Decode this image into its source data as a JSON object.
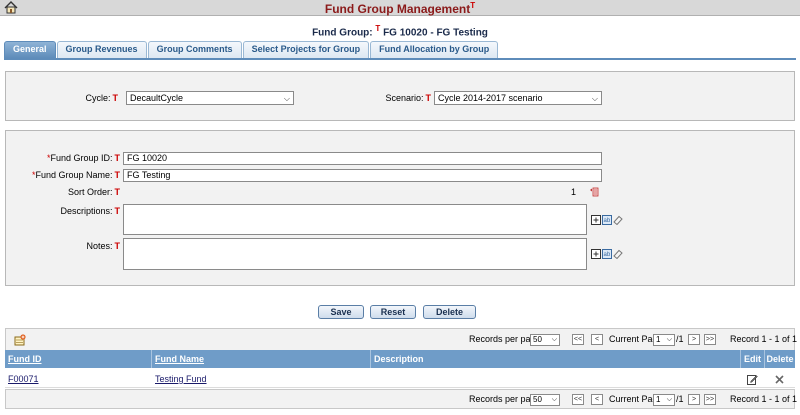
{
  "title_bar": {
    "title": "Fund Group Management",
    "t_marker": "T"
  },
  "fund_group": {
    "label": "Fund Group:",
    "t_marker": "T",
    "value": "FG 10020 - FG Testing"
  },
  "tabs": [
    {
      "label": "General",
      "active": true
    },
    {
      "label": "Group Revenues",
      "active": false
    },
    {
      "label": "Group Comments",
      "active": false
    },
    {
      "label": "Select Projects for Group",
      "active": false
    },
    {
      "label": "Fund Allocation by Group",
      "active": false
    }
  ],
  "filters": {
    "cycle": {
      "label": "Cycle:",
      "t_marker": "T",
      "value": "DecaultCycle"
    },
    "scenario": {
      "label": "Scenario:",
      "t_marker": "T",
      "value": "Cycle 2014-2017 scenario"
    }
  },
  "form": {
    "required_mark": "*",
    "fund_group_id": {
      "label": "Fund Group ID:",
      "t_marker": "T",
      "value": "FG 10020"
    },
    "fund_group_name": {
      "label": "Fund Group Name:",
      "t_marker": "T",
      "value": "FG Testing"
    },
    "sort_order": {
      "label": "Sort Order:",
      "t_marker": "T",
      "value": "1"
    },
    "descriptions": {
      "label": "Descriptions:",
      "t_marker": "T",
      "value": ""
    },
    "notes": {
      "label": "Notes:",
      "t_marker": "T",
      "value": ""
    }
  },
  "actions": {
    "save": "Save",
    "reset": "Reset",
    "delete": "Delete"
  },
  "pager": {
    "records_per_page_label": "Records per page",
    "records_per_page": "50",
    "first": "<<",
    "prev": "<",
    "current_page_label": "Current Page",
    "current_page": "1",
    "total_pages": "/1",
    "next": ">",
    "last": ">>",
    "record_range": "Record 1 - 1 of 1"
  },
  "grid": {
    "columns": {
      "fund_id": "Fund ID",
      "fund_name": "Fund Name",
      "description": "Description",
      "edit": "Edit",
      "delete": "Delete"
    },
    "rows": [
      {
        "fund_id": "F00071",
        "fund_name": "Testing Fund",
        "description": ""
      }
    ]
  },
  "colors": {
    "title": "#8b1a1a",
    "tab_active": "#5e8cba",
    "grid_header": "#6f9cc8",
    "required": "#cc0000"
  },
  "icons": [
    "home-icon",
    "sort-order-icon",
    "expand-icon",
    "spellcheck-icon",
    "eraser-icon",
    "add-record-icon",
    "edit-icon",
    "delete-icon",
    "chevron-down-icon"
  ]
}
